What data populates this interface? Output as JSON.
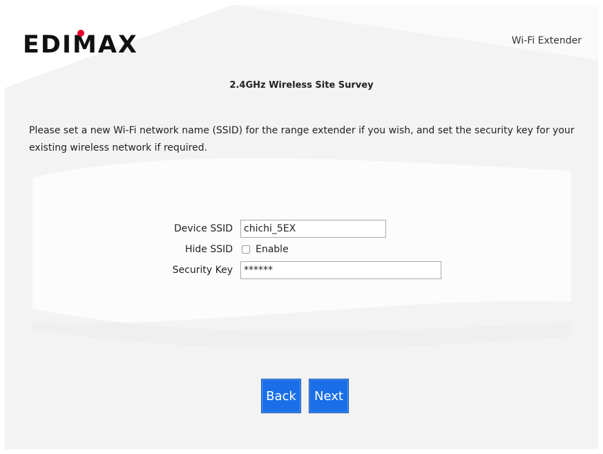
{
  "header": {
    "brand": "EDIMAX",
    "product": "Wi-Fi Extender"
  },
  "page": {
    "title": "2.4GHz Wireless Site Survey",
    "description": "Please set a new Wi-Fi network name (SSID) for the range extender if you wish, and set the security key for your existing wireless network if required."
  },
  "form": {
    "device_ssid": {
      "label": "Device SSID",
      "value": "chichi_5EX"
    },
    "hide_ssid": {
      "label": "Hide SSID",
      "option_label": "Enable",
      "checked": false
    },
    "security_key": {
      "label": "Security Key",
      "value": "******"
    }
  },
  "buttons": {
    "back": "Back",
    "next": "Next"
  },
  "colors": {
    "brand_red": "#e4002b",
    "button_blue": "#1a6fe8"
  }
}
